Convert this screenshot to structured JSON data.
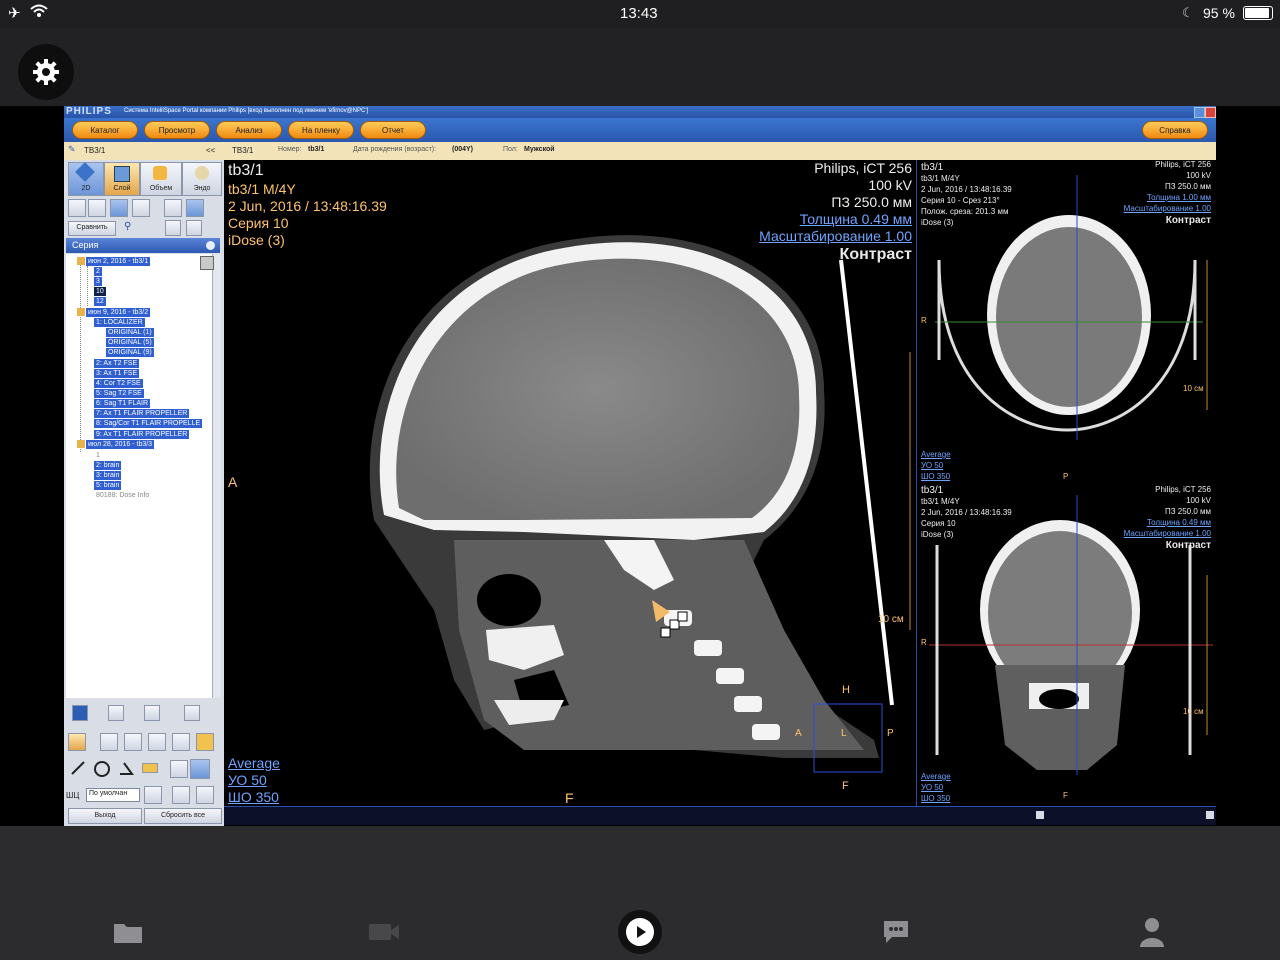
{
  "status_bar": {
    "time": "13:43",
    "battery": "95 %"
  },
  "app": {
    "settings_icon": "gear-icon"
  },
  "window": {
    "title": "PHILIPS",
    "title_text": "Система IntelliSpace Portal компании Philips [вход выполнен под именем 'efimov@NPC']"
  },
  "menu": {
    "items": [
      "Каталог",
      "Просмотр",
      "Анализ",
      "На пленку",
      "Отчет"
    ],
    "help": "Справка"
  },
  "patient_bar": {
    "left_tab": "ТВ3/1",
    "collapse": "<<",
    "name": "ТВ3/1",
    "id_label": "Номер:",
    "id_value": "tb3/1",
    "dob_label": "Дата рождения (возраст):",
    "dob_value": "(004Y)",
    "sex_label": "Пол:",
    "sex_value": "Мужской"
  },
  "left_panel": {
    "view_tabs": [
      "2D",
      "Слой",
      "Объем",
      "Эндо"
    ],
    "compare_label": "Сравнить",
    "series_header": "Серия",
    "tree": [
      "июн 2, 2016 - tb3/1",
      "2",
      "3",
      "10",
      "12",
      "июн 9, 2016 - tb3/2",
      "1: LOCALIZER",
      "ORIGINAL (1)",
      "ORIGINAL (5)",
      "ORIGINAL (9)",
      "2: Ax T2 FSE",
      "3: Ax T1 FSE",
      "4: Cor T2 FSE",
      "5: Sag T2 FSE",
      "6: Sag T1 FLAIR",
      "7: Ax T1 FLAIR PROPELLER",
      "8: Sag/Cor T1 FLAIR PROPELLE",
      "9: Ax T1 FLAIR PROPELLER",
      "июл 28, 2016 - tb3/3",
      "1",
      "2: brain",
      "3: brain",
      "5: brain",
      "80188: Dose Info"
    ],
    "wl_label": "ШЦ",
    "wl_value": "По умолчан",
    "exit_label": "Выход",
    "reset_label": "Сбросить все"
  },
  "main_viewport": {
    "tl": [
      "tb3/1",
      "tb3/1 M/4Y",
      "2 Jun, 2016 / 13:48:16.39",
      "Серия 10",
      "iDose (3)"
    ],
    "tr": [
      "Philips, iCT 256",
      "100 kV",
      "ПЗ 250.0 мм"
    ],
    "tr_links": [
      "Толщина 0.49 мм",
      "Масштабирование 1.00"
    ],
    "contrast": "Контраст",
    "bl": [
      "Average",
      "УО    50",
      "ШО   350"
    ],
    "orient_left": "A",
    "orient_bottom": "F",
    "scale": "10 см",
    "loc_h": "H",
    "loc_a": "A",
    "loc_l": "L",
    "loc_p": "P",
    "loc_f": "F"
  },
  "right_top": {
    "tl": [
      "tb3/1",
      "tb3/1 M/4Y",
      "2 Jun, 2016 / 13:48:16.39",
      "Серия 10 - Срез 213°",
      "Полож. среза: 201.3 мм",
      "iDose (3)"
    ],
    "tr": [
      "Philips, iCT 256",
      "100 kV",
      "ПЗ 250.0 мм"
    ],
    "tr_links": [
      "Толщина 1.00 мм",
      "Масштабирование 1.00"
    ],
    "contrast": "Контраст",
    "bl": [
      "Average",
      "УО    50",
      "ШО   350"
    ],
    "orient_r": "R",
    "orient_p": "P",
    "scale": "10 см"
  },
  "right_bottom": {
    "tl": [
      "tb3/1",
      "tb3/1 M/4Y",
      "2 Jun, 2016 / 13:48:16.39",
      "Серия 10",
      "iDose (3)"
    ],
    "tr": [
      "Philips, iCT 256",
      "100 kV",
      "ПЗ 250.0 мм"
    ],
    "tr_links": [
      "Толщина 0.49 мм",
      "Масштабирование 1.00"
    ],
    "contrast": "Контраст",
    "bl": [
      "Average",
      "УО    50",
      "ШО   350"
    ],
    "orient_r": "R",
    "orient_f": "F",
    "scale": "10 см"
  },
  "bottom_bar": {
    "icons": [
      "folder-icon",
      "video-camera-icon",
      "play-icon",
      "chat-icon",
      "person-icon"
    ]
  }
}
